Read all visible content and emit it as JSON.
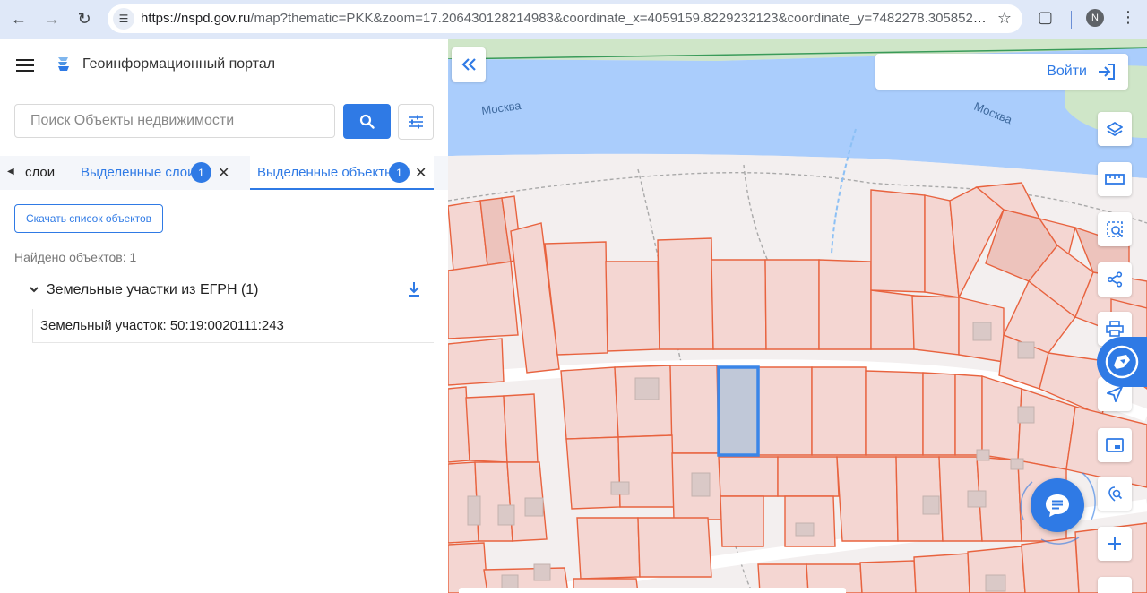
{
  "browser": {
    "url_host": "https://nspd.gov.ru",
    "url_rest": "/map?thematic=PKK&zoom=17.206430128214983&coordinate_x=4059159.8229232123&coordinate_y=7482278.305852124&them...",
    "avatar_letter": "N"
  },
  "header": {
    "title": "Геоинформационный портал"
  },
  "search": {
    "placeholder": "Поиск Объекты недвижимости"
  },
  "tabs": [
    {
      "label": "слои"
    },
    {
      "label": "Выделенные слои",
      "count": "1"
    },
    {
      "label": "Выделенные объекты",
      "count": "1",
      "active": true
    }
  ],
  "results": {
    "download_label": "Скачать список объектов",
    "found_text": "Найдено объектов: 1",
    "group_label": "Земельные участки из ЕГРН (1)",
    "item_label": "Земельный участок: 50:19:0020111:243"
  },
  "map": {
    "river_labels": [
      "Москва",
      "Москва"
    ],
    "login_label": "Войти",
    "colors": {
      "water": "#aacdfc",
      "parcel_fill": "#f4d6d2",
      "parcel_stroke": "#e8633f",
      "selected_fill": "#c0c8d8",
      "selected_stroke": "#3a86e8",
      "accent": "#2f7ae5"
    },
    "tools": [
      "layers-icon",
      "ruler-icon",
      "select-area-icon",
      "share-icon",
      "print-icon",
      "navigate-icon",
      "pip-icon",
      "geosearch-icon",
      "zoom-in-icon"
    ]
  }
}
